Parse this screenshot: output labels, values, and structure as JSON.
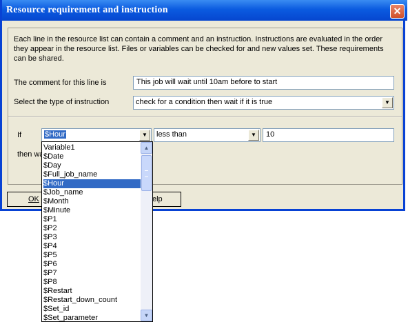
{
  "window": {
    "title": "Resource requirement and instruction",
    "close_glyph": "✕"
  },
  "description": "Each line in the resource list can contain a comment and an instruction.  Instructions are evaluated in the order they appear in the resource list.  Files or variables can be checked for and new values set.  These requirements can be shared.",
  "comment": {
    "label": "The comment for this line is",
    "value": "This job will wait until 10am before to start"
  },
  "instruction": {
    "label": "Select the type of instruction",
    "value": "check for a condition then wait if it is true"
  },
  "condition": {
    "if_label": "If",
    "variable": "$Hour",
    "operator": "less than",
    "value": "10",
    "then_label": "then wa"
  },
  "buttons": {
    "ok": "OK",
    "help": "elp"
  },
  "dropdown": {
    "selected_index": 5,
    "options": [
      "Variable1",
      "$Date",
      "$Day",
      "$Full_job_name",
      "$Hour",
      "$Job_name",
      "$Month",
      "$Minute",
      "$P1",
      "$P2",
      "$P3",
      "$P4",
      "$P5",
      "$P6",
      "$P7",
      "$P8",
      "$Restart",
      "$Restart_down_count",
      "$Set_id",
      "$Set_parameter"
    ]
  },
  "colors": {
    "title_bar": "#0b5be0",
    "selection": "#316ac5",
    "dialog_bg": "#ece9d8"
  }
}
